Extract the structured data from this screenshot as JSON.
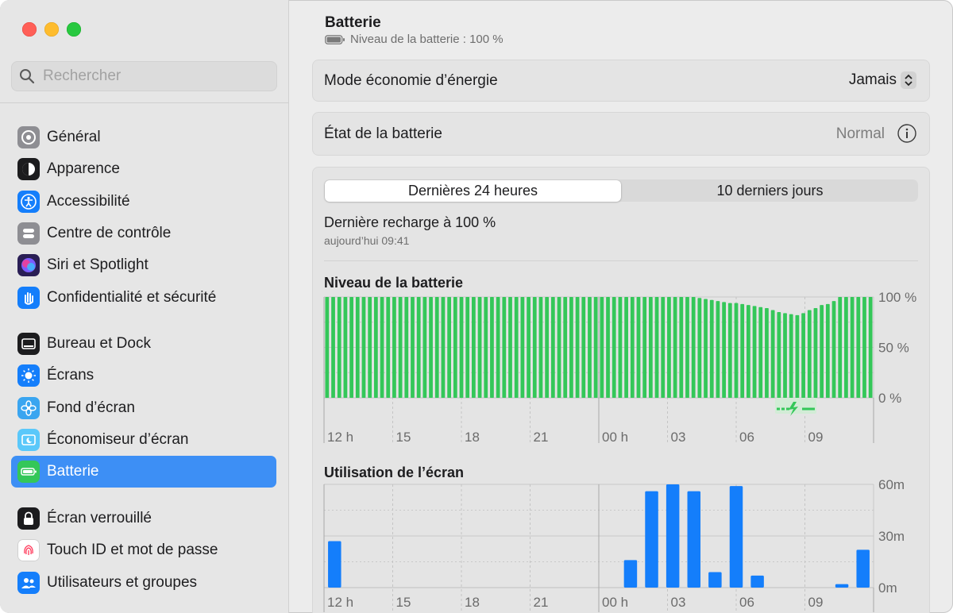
{
  "sidebar": {
    "search_placeholder": "Rechercher",
    "groups": [
      [
        {
          "label": "Général",
          "icon": "gear-icon",
          "color": "#8e8e93"
        },
        {
          "label": "Apparence",
          "icon": "appearance-icon",
          "color": "#1c1c1e"
        },
        {
          "label": "Accessibilité",
          "icon": "accessibility-icon",
          "color": "#147efb"
        },
        {
          "label": "Centre de contrôle",
          "icon": "control-center-icon",
          "color": "#8e8e93"
        },
        {
          "label": "Siri et Spotlight",
          "icon": "siri-icon",
          "color": "#2a1e55"
        },
        {
          "label": "Confidentialité et sécurité",
          "icon": "hand-icon",
          "color": "#147efb"
        }
      ],
      [
        {
          "label": "Bureau et Dock",
          "icon": "dock-icon",
          "color": "#1c1c1e"
        },
        {
          "label": "Écrans",
          "icon": "sun-icon",
          "color": "#147efb"
        },
        {
          "label": "Fond d’écran",
          "icon": "flower-icon",
          "color": "#3aa5f0"
        },
        {
          "label": "Économiseur d’écran",
          "icon": "screensaver-icon",
          "color": "#5ac8fa"
        },
        {
          "label": "Batterie",
          "icon": "battery-icon",
          "color": "#34c759",
          "selected": true
        }
      ],
      [
        {
          "label": "Écran verrouillé",
          "icon": "lock-icon",
          "color": "#1c1c1e"
        },
        {
          "label": "Touch ID et mot de passe",
          "icon": "fingerprint-icon",
          "color": "#ffffff"
        },
        {
          "label": "Utilisateurs et groupes",
          "icon": "users-icon",
          "color": "#147efb"
        }
      ]
    ]
  },
  "header": {
    "title": "Batterie",
    "subtitle": "Niveau de la batterie : 100 %"
  },
  "settings": {
    "power_mode": {
      "label": "Mode économie d’énergie",
      "value": "Jamais"
    },
    "battery_health": {
      "label": "État de la batterie",
      "value": "Normal"
    }
  },
  "usage": {
    "tabs": [
      "Dernières 24 heures",
      "10 derniers jours"
    ],
    "active_tab": 0,
    "last_charge": "Dernière recharge à 100 %",
    "last_charge_time": "aujourd’hui 09:41"
  },
  "chart_data": [
    {
      "type": "bar",
      "title": "Niveau de la batterie",
      "x_ticks": [
        "12 h",
        "15",
        "18",
        "21",
        "00 h",
        "03",
        "06",
        "09"
      ],
      "y_ticks": [
        "100 %",
        "50 %",
        "0 %"
      ],
      "ylim": [
        0,
        100
      ],
      "unit": "%",
      "values": [
        100,
        100,
        100,
        100,
        100,
        100,
        100,
        100,
        100,
        100,
        100,
        100,
        100,
        100,
        100,
        100,
        100,
        100,
        100,
        100,
        100,
        100,
        100,
        100,
        100,
        100,
        100,
        100,
        100,
        100,
        100,
        100,
        100,
        100,
        100,
        100,
        100,
        100,
        100,
        100,
        100,
        100,
        100,
        100,
        100,
        100,
        100,
        100,
        100,
        100,
        100,
        100,
        100,
        100,
        100,
        100,
        100,
        100,
        100,
        100,
        100,
        99,
        98,
        97,
        96,
        95,
        94,
        94,
        93,
        92,
        91,
        90,
        89,
        87,
        85,
        84,
        83,
        82,
        84,
        87,
        89,
        92,
        93,
        96,
        100,
        100,
        100,
        100,
        100,
        100
      ],
      "charging": true,
      "color": "#34c759"
    },
    {
      "type": "bar",
      "title": "Utilisation de l’écran",
      "x_ticks": [
        "12 h",
        "15",
        "18",
        "21",
        "00 h",
        "03",
        "06",
        "09"
      ],
      "y_ticks": [
        "60m",
        "30m",
        "0m"
      ],
      "ylim": [
        0,
        60
      ],
      "unit": "min",
      "values": [
        27,
        0,
        0,
        0,
        0,
        0,
        0,
        0,
        0,
        0,
        0,
        0,
        0,
        0,
        16,
        56,
        60,
        56,
        9,
        59,
        7,
        0,
        0,
        0,
        2,
        22
      ],
      "color": "#147efb"
    }
  ],
  "colors": {
    "accent": "#3d8ff5",
    "battery_green": "#34c759",
    "usage_blue": "#147efb"
  }
}
